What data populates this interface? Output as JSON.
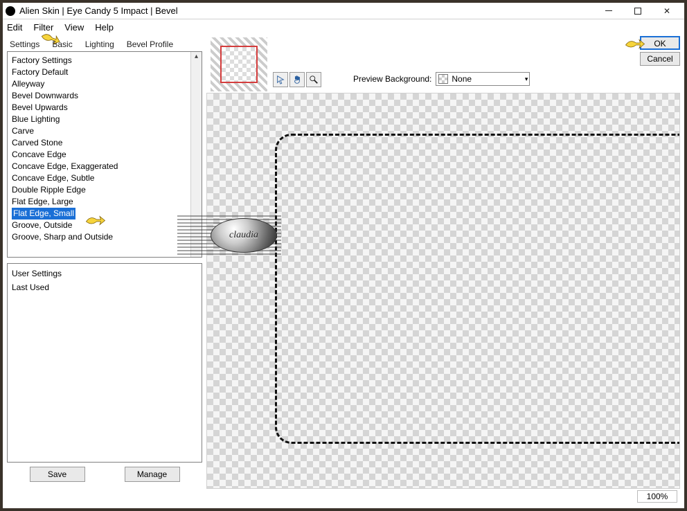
{
  "window": {
    "title": "Alien Skin | Eye Candy 5 Impact | Bevel"
  },
  "menu": [
    "Edit",
    "Filter",
    "View",
    "Help"
  ],
  "tabs": [
    "Settings",
    "Basic",
    "Lighting",
    "Bevel Profile"
  ],
  "dialog": {
    "ok": "OK",
    "cancel": "Cancel"
  },
  "presets": {
    "header": "Factory Settings",
    "items": [
      "Factory Default",
      "Alleyway",
      "Bevel Downwards",
      "Bevel Upwards",
      "Blue Lighting",
      "Carve",
      "Carved Stone",
      "Concave Edge",
      "Concave Edge, Exaggerated",
      "Concave Edge, Subtle",
      "Double Ripple Edge",
      "Flat Edge, Large",
      "Flat Edge, Small",
      "Groove, Outside",
      "Groove, Sharp and Outside"
    ],
    "selected_index": 12
  },
  "user_presets": {
    "items": [
      "User Settings",
      "Last Used"
    ]
  },
  "buttons": {
    "save": "Save",
    "manage": "Manage"
  },
  "preview": {
    "label": "Preview Background:",
    "value": "None"
  },
  "zoom": "100%",
  "watermark": "claudia"
}
